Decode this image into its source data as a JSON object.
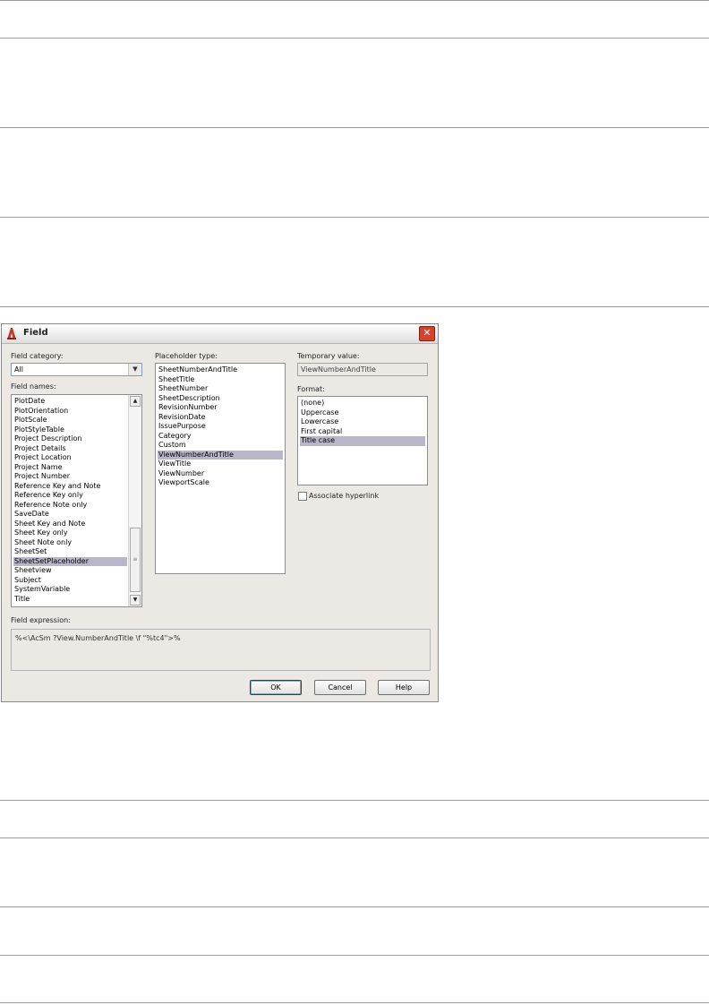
{
  "dialog": {
    "title": "Field",
    "close_glyph": "✕",
    "field_category_label": "Field category:",
    "field_category_value": "All",
    "field_names_label": "Field names:",
    "field_names": [
      "PlotDate",
      "PlotOrientation",
      "PlotScale",
      "PlotStyleTable",
      "Project Description",
      "Project Details",
      "Project Location",
      "Project Name",
      "Project Number",
      "Reference Key and Note",
      "Reference Key only",
      "Reference Note only",
      "SaveDate",
      "Sheet Key and Note",
      "Sheet Key only",
      "Sheet Note only",
      "SheetSet",
      "SheetSetPlaceholder",
      "Sheetview",
      "Subject",
      "SystemVariable",
      "Title"
    ],
    "field_names_selected": "SheetSetPlaceholder",
    "placeholder_type_label": "Placeholder type:",
    "placeholder_types": [
      "SheetNumberAndTitle",
      "SheetTitle",
      "SheetNumber",
      "SheetDescription",
      "RevisionNumber",
      "RevisionDate",
      "IssuePurpose",
      "Category",
      "Custom",
      "ViewNumberAndTitle",
      "ViewTitle",
      "ViewNumber",
      "ViewportScale"
    ],
    "placeholder_type_selected": "ViewNumberAndTitle",
    "temporary_value_label": "Temporary value:",
    "temporary_value": "ViewNumberAndTitle",
    "format_label": "Format:",
    "formats": [
      "(none)",
      "Uppercase",
      "Lowercase",
      "First capital",
      "Title case"
    ],
    "format_selected": "Title case",
    "associate_hyperlink_label": "Associate hyperlink",
    "field_expression_label": "Field expression:",
    "field_expression": "%<\\AcSm ?View.NumberAndTitle \\f \"%tc4\">%",
    "buttons": {
      "ok": "OK",
      "cancel": "Cancel",
      "help": "Help"
    }
  },
  "colors": {
    "selection": "#b8b6c8",
    "dialog_bg": "#ece9e4",
    "close": "#d6432b"
  }
}
